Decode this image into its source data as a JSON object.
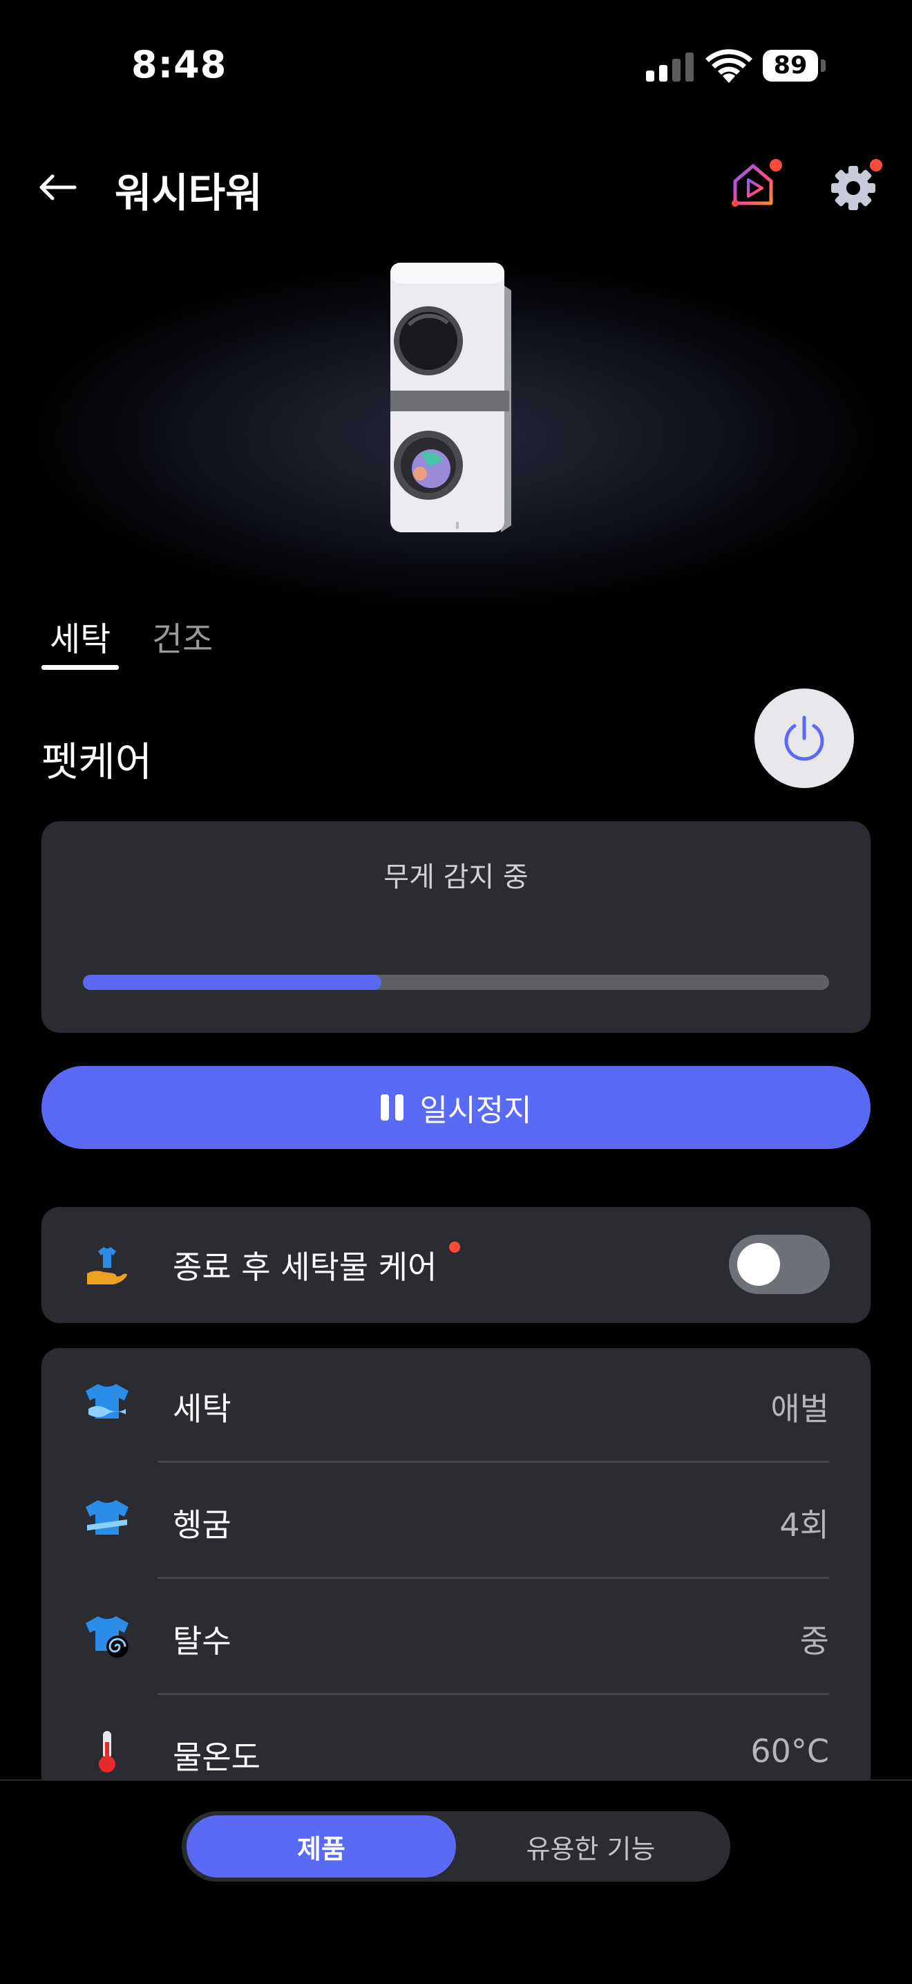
{
  "status_bar": {
    "time": "8:48",
    "battery": "89"
  },
  "header": {
    "title": "워시타워"
  },
  "tabs": [
    {
      "label": "세탁",
      "active": true
    },
    {
      "label": "건조",
      "active": false
    }
  ],
  "course": {
    "name": "펫케어"
  },
  "status": {
    "text": "무게 감지 중",
    "progress": 0.4
  },
  "pause_button": {
    "label": "일시정지"
  },
  "care": {
    "label": "종료 후 세탁물 케어",
    "enabled": false
  },
  "options": [
    {
      "icon": "wash-shirt-icon",
      "label": "세탁",
      "value": "애벌"
    },
    {
      "icon": "rinse-shirt-icon",
      "label": "헹굼",
      "value": "4회"
    },
    {
      "icon": "spin-shirt-icon",
      "label": "탈수",
      "value": "중"
    },
    {
      "icon": "thermometer-icon",
      "label": "물온도",
      "value": "60°C"
    }
  ],
  "bottom_nav": {
    "active": "제품",
    "other": "유용한 기능"
  },
  "colors": {
    "accent": "#5a6af5",
    "notification": "#ff4b3a",
    "card": "#2a2c31"
  }
}
